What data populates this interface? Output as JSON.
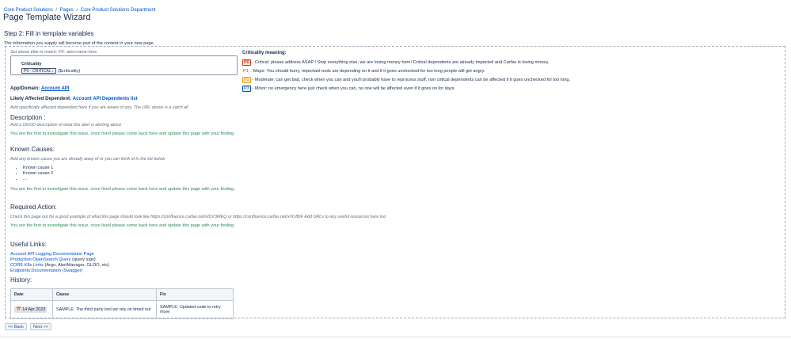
{
  "breadcrumb": [
    "Core Product Solutions",
    "Pages",
    "Core Product Solutions Department"
  ],
  "breadcrumb_sep": "/",
  "page_title": "Page Template Wizard",
  "step_title": "Step 2: Fill in template variables",
  "info_text": "The information you supply will become part of the content in your new page.",
  "hint_title": "Set above tittle to match: PX: alert-name-here",
  "criticality": {
    "label": "Criticality",
    "selected": "P0 - CRITICAL",
    "variable": "$criticality"
  },
  "app_domain": {
    "label": "App/Domain:",
    "value": "Account API"
  },
  "dependent": {
    "label": "Likely Affected Dependent:",
    "value": "Account API Dependents list"
  },
  "dependent_hint": "Add specifically affected dependent here if you are aware of any. The URL above is a catch all",
  "description": {
    "title": "Description :",
    "hint": "Add a GOOD description of what this alert is alerting about",
    "note": "You are the first to investigate this issue, once fixed please come back here and update this page with your finding."
  },
  "known_causes": {
    "title": "Known Causes:",
    "hint": "Add any known cause you are already away of or you can think of in the list below",
    "items": [
      "Known cause 1",
      "Known cause 2",
      "...."
    ],
    "note": "You are the first to investigate this issue, once fixed please come back here and update this page with your finding."
  },
  "required_action": {
    "title": "Required Action:",
    "hint": "Check this page out for a good example of what this page should look like https://confluence.carfax.net/x/DV3MEQ or https://confluence.carfax.net/x/XUBIF Add URLs to any useful resources here too",
    "note": "You are the first to investigate this issue, once fixed please come back here and update this page with your finding."
  },
  "useful_links": {
    "title": "Useful Links:",
    "items": [
      {
        "link": "Account API Logging Documentation Page",
        "extra": ""
      },
      {
        "link": "Production OpenSearch Query",
        "extra": "(query logs)"
      },
      {
        "link": "CORE K8s Links",
        "extra": "(Argo, AlertManager, GLOO, etc)"
      },
      {
        "link": "Endpoints Documentation (Swagger)",
        "extra": ""
      }
    ]
  },
  "history": {
    "title": "History:",
    "headers": [
      "Date",
      "Cause",
      "Fix"
    ],
    "rows": [
      {
        "date": "14 Apr 2023",
        "cause": "SAMPLE: The third party tool we rely on timed out",
        "fix": "SAMPLE: Updated code to retry more"
      }
    ]
  },
  "legend": {
    "title": "Criticality meaning:",
    "rows": [
      {
        "tag": "P0",
        "text": " - Critical: please address ASAP ! Stop everything else, we are losing money here!  Critical dependents are already impacted and Carfax is losing money."
      },
      {
        "tag": "P1",
        "text": " - Major: You should hurry, important tools are depending on it and if it goes unchecked for too long people will get angry."
      },
      {
        "tag": "P2",
        "text": " - Moderate: can get bad, check when you can and you'll probably have to reprocess stuff, non critical dependents can be affected if it goes unchecked for too long."
      },
      {
        "tag": "P3",
        "text": " - Minor: no emergency here just check when you can, no one will be affected even if it goes on for days."
      }
    ]
  },
  "buttons": {
    "back": "<< Back",
    "next": "Next >>"
  },
  "colors": {
    "link": "#0052cc",
    "green_note": "#2e8b57",
    "p0": "#de350b",
    "p2": "#ff8b00"
  }
}
